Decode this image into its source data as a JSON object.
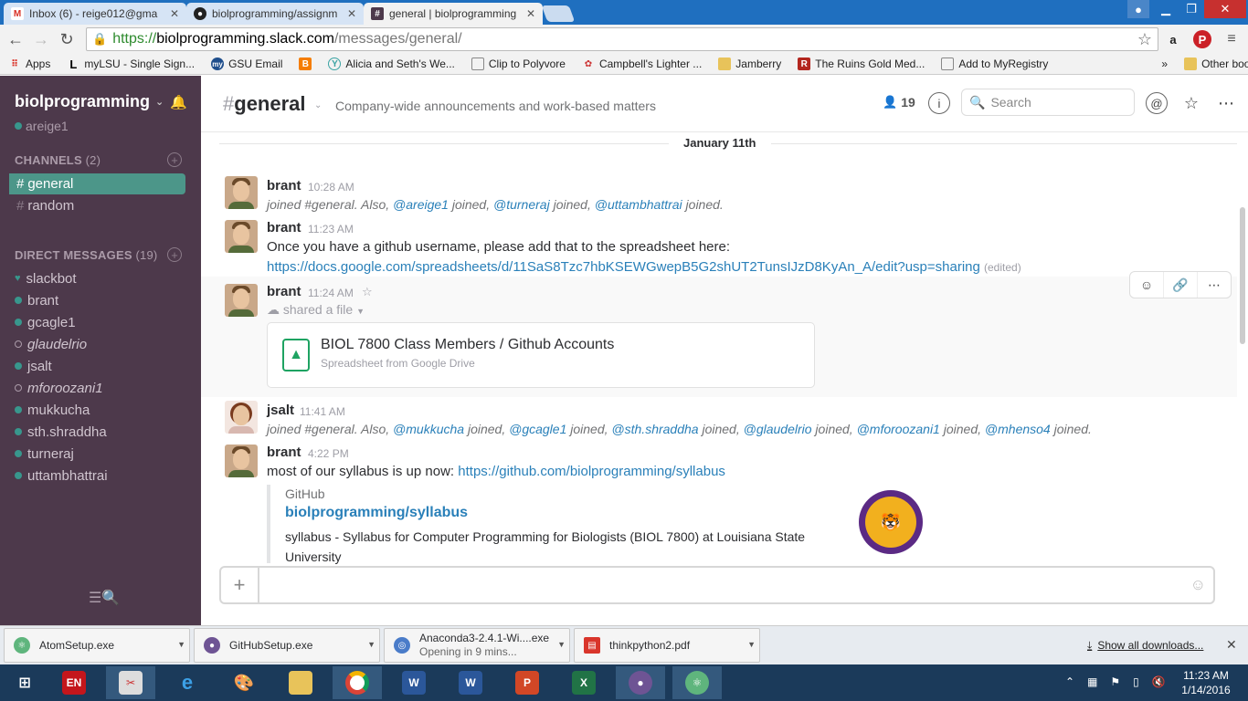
{
  "browser": {
    "tabs": [
      {
        "icon": "gmail-icon",
        "label": "Inbox (6) - reige012@gma",
        "active": false
      },
      {
        "icon": "github-icon",
        "label": "biolprogramming/assignm",
        "active": false
      },
      {
        "icon": "slack-icon",
        "label": "general | biolprogramming",
        "active": true
      }
    ],
    "url_proto": "https://",
    "url_host": "biolprogramming.slack.com",
    "url_path": "/messages/general/",
    "extensions": [
      "amazon-icon",
      "pinterest-icon",
      "menu-icon"
    ],
    "bookmarks": [
      {
        "label": "Apps",
        "icon": "apps-icon"
      },
      {
        "label": "myLSU - Single Sign...",
        "icon": "lsu-icon"
      },
      {
        "label": "GSU Email",
        "icon": "my-icon"
      },
      {
        "label": "",
        "icon": "blogger-icon"
      },
      {
        "label": "Alicia and Seth's We...",
        "icon": "wedding-icon"
      },
      {
        "label": "Clip to Polyvore",
        "icon": "page-icon"
      },
      {
        "label": "Campbell's Lighter ...",
        "icon": "campbells-icon"
      },
      {
        "label": "Jamberry",
        "icon": "folder-icon"
      },
      {
        "label": "The Ruins Gold Med...",
        "icon": "ruins-icon"
      },
      {
        "label": "Add to MyRegistry",
        "icon": "page-icon"
      }
    ],
    "bookmarks_more": "»",
    "other_bookmarks": "Other bookmarks"
  },
  "sidebar": {
    "team_name": "biolprogramming",
    "user": "areige1",
    "channels_label": "CHANNELS",
    "channels_count": "(2)",
    "channels": [
      {
        "name": "general",
        "active": true
      },
      {
        "name": "random",
        "active": false
      }
    ],
    "dm_label": "DIRECT MESSAGES",
    "dm_count": "(19)",
    "dms": [
      {
        "name": "slackbot",
        "status": "bot"
      },
      {
        "name": "brant",
        "status": "online"
      },
      {
        "name": "gcagle1",
        "status": "online"
      },
      {
        "name": "glaudelrio",
        "status": "away"
      },
      {
        "name": "jsalt",
        "status": "online"
      },
      {
        "name": "mforoozani1",
        "status": "away"
      },
      {
        "name": "mukkucha",
        "status": "online"
      },
      {
        "name": "sth.shraddha",
        "status": "online"
      },
      {
        "name": "turneraj",
        "status": "online"
      },
      {
        "name": "uttambhattrai",
        "status": "online"
      }
    ]
  },
  "header": {
    "hash": "#",
    "channel": "general",
    "topic": "Company-wide announcements and work-based matters",
    "member_count": "19",
    "search_placeholder": "Search"
  },
  "day_divider": "January 11th",
  "messages": [
    {
      "author": "brant",
      "time": "10:28 AM",
      "parts": [
        "joined #general. Also, ",
        "@areige1",
        " joined, ",
        "@turneraj",
        " joined, ",
        "@uttambhattrai",
        " joined."
      ]
    },
    {
      "author": "brant",
      "time": "11:23 AM",
      "text": "Once you have a github username, please add that to the spreadsheet here:",
      "link": "https://docs.google.com/spreadsheets/d/11SaS8Tzc7hbKSEWGwepB5G2shUT2TunsIJzD8KyAn_A/edit?usp=sharing",
      "edited": "(edited)"
    },
    {
      "author": "brant",
      "time": "11:24 AM",
      "shared": "shared a file",
      "file_title": "BIOL 7800 Class Members / Github Accounts",
      "file_sub": "Spreadsheet from Google Drive"
    },
    {
      "author": "jsalt",
      "time": "11:41 AM",
      "parts": [
        "joined #general. Also, ",
        "@mukkucha",
        " joined, ",
        "@gcagle1",
        " joined, ",
        "@sth.shraddha",
        " joined, ",
        "@glaudelrio",
        " joined, ",
        "@mforoozani1",
        " joined, ",
        "@mhenso4",
        " joined."
      ]
    },
    {
      "author": "brant",
      "time": "4:22 PM",
      "text": "most of our syllabus is up now: ",
      "link": "https://github.com/biolprogramming/syllabus",
      "unfurl_service": "GitHub",
      "unfurl_title": "biolprogramming/syllabus",
      "unfurl_desc": "syllabus - Syllabus for Computer Programming for Biologists (BIOL 7800) at Louisiana State University"
    }
  ],
  "downloads": [
    {
      "name": "AtomSetup.exe",
      "sub": "",
      "color": "#5fb57d"
    },
    {
      "name": "GitHubSetup.exe",
      "sub": "",
      "color": "#6e5494"
    },
    {
      "name": "Anaconda3-2.4.1-Wi....exe",
      "sub": "Opening in 9 mins...",
      "color": "#4a7cc9"
    },
    {
      "name": "thinkpython2.pdf",
      "sub": "",
      "color": "#d9352b"
    }
  ],
  "show_all": "Show all downloads...",
  "clock_time": "11:23 AM",
  "clock_date": "1/14/2016"
}
